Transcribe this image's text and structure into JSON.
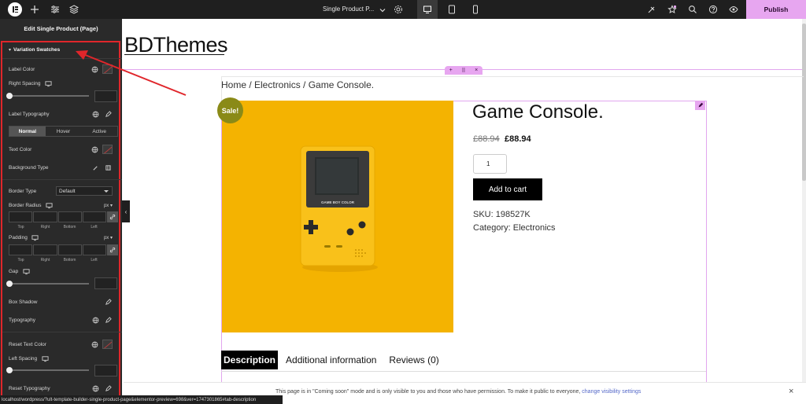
{
  "topbar": {
    "doc_title": "Single Product P...",
    "publish_label": "Publish"
  },
  "sidebar": {
    "title": "Edit Single Product (Page)",
    "section_title": "Variation Swatches",
    "label_color": "Label Color",
    "right_spacing": "Right Spacing",
    "label_typography": "Label Typography",
    "state_tabs": [
      "Normal",
      "Hover",
      "Active"
    ],
    "text_color": "Text Color",
    "background_type": "Background Type",
    "border_type": "Border Type",
    "border_type_value": "Default",
    "border_radius": "Border Radius",
    "unit": "px",
    "dim_labels": [
      "Top",
      "Right",
      "Bottom",
      "Left"
    ],
    "padding": "Padding",
    "gap": "Gap",
    "box_shadow": "Box Shadow",
    "typography": "Typography",
    "reset_text_color": "Reset Text Color",
    "left_spacing": "Left Spacing",
    "reset_typography": "Reset Typography"
  },
  "canvas": {
    "site_title": "BDThemes",
    "breadcrumb": "Home / Electronics / Game Console.",
    "sale_badge": "Sale!",
    "product_title": "Game Console.",
    "price_old": "£88.94",
    "price_new": "£88.94",
    "quantity": "1",
    "add_to_cart": "Add to cart",
    "sku": "SKU: 198527K",
    "category": "Category: Electronics",
    "tabs": [
      "Description",
      "Additional information",
      "Reviews (0)"
    ],
    "gameboy_label": "GAME BOY COLOR"
  },
  "notice": {
    "text": "This page is in \"Coming soon\" mode and is only visible to you and those who have permission. To make it public to everyone, ",
    "link": "change visibility settings"
  },
  "statusbar": {
    "url": "localhost/wordpress/?ult-template-builder-single-product-page&elementor-preview=698&ver=1747301865#tab-description"
  },
  "colors": {
    "accent": "#e7a6f0",
    "sidebar_bg": "#2a2a2a",
    "product_bg": "#f4b301",
    "sale_badge": "#8a8a17",
    "annotation": "#e0262b"
  }
}
